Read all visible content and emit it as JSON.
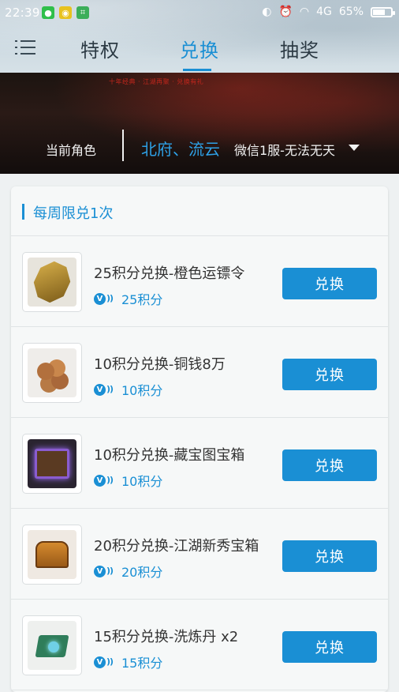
{
  "status_bar": {
    "time": "22:39",
    "network": "4G",
    "battery": "65%"
  },
  "tabs": [
    {
      "label": "特权",
      "active": false
    },
    {
      "label": "兑换",
      "active": true
    },
    {
      "label": "抽奖",
      "active": false
    }
  ],
  "banner": {
    "red_text": "十年经典 · 江湖再聚 · 兑换有礼",
    "role_label": "当前角色",
    "role_name": "北府、流云",
    "server": "微信1服-无法无天"
  },
  "section": {
    "title": "每周限兑1次"
  },
  "items": [
    {
      "name": "25积分兑换-橙色运镖令",
      "cost": "25积分",
      "button": "兑换",
      "icon": "escort-token-icon"
    },
    {
      "name": "10积分兑换-铜钱8万",
      "cost": "10积分",
      "button": "兑换",
      "icon": "copper-coins-icon"
    },
    {
      "name": "10积分兑换-藏宝图宝箱",
      "cost": "10积分",
      "button": "兑换",
      "icon": "treasure-map-chest-icon"
    },
    {
      "name": "20积分兑换-江湖新秀宝箱",
      "cost": "20积分",
      "button": "兑换",
      "icon": "newcomer-chest-icon"
    },
    {
      "name": "15积分兑换-洗炼丹 x2",
      "cost": "15积分",
      "button": "兑换",
      "icon": "refining-pill-icon"
    }
  ],
  "colors": {
    "accent": "#1a8fd4",
    "card_bg": "#f6f8f8"
  }
}
